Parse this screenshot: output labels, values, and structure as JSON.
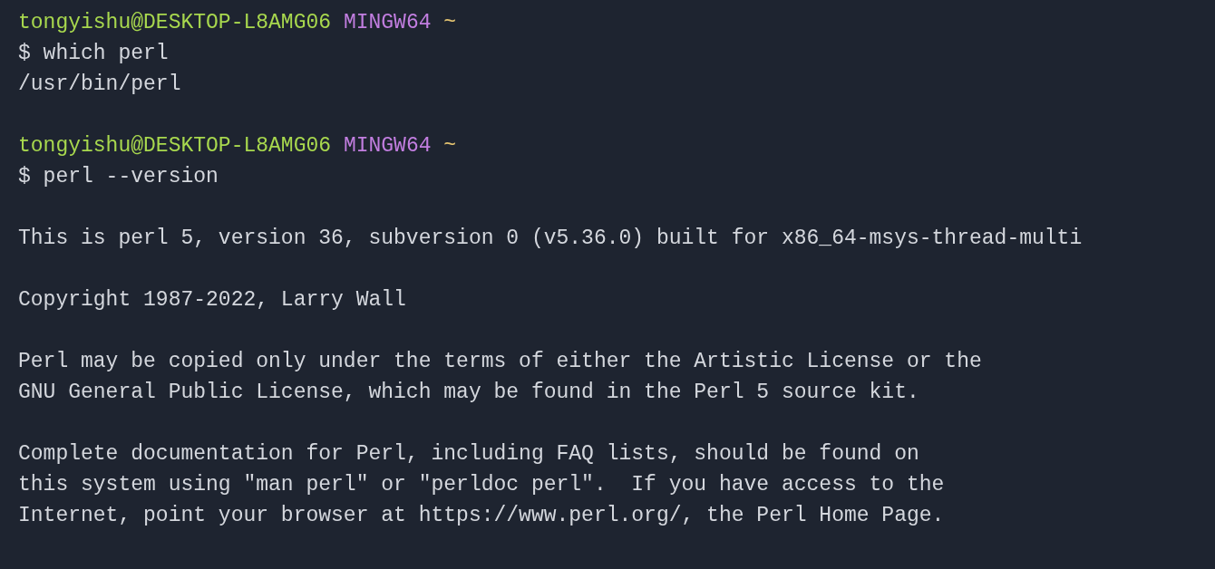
{
  "terminal": {
    "lines": [
      {
        "kind": "prompt",
        "user_host": "tongyishu@DESKTOP-L8AMG06",
        "system": "MINGW64",
        "path": "~"
      },
      {
        "kind": "command",
        "text": "$ which perl"
      },
      {
        "kind": "output",
        "text": "/usr/bin/perl"
      },
      {
        "kind": "blank"
      },
      {
        "kind": "prompt",
        "user_host": "tongyishu@DESKTOP-L8AMG06",
        "system": "MINGW64",
        "path": "~"
      },
      {
        "kind": "command",
        "text": "$ perl --version"
      },
      {
        "kind": "blank"
      },
      {
        "kind": "output",
        "text": "This is perl 5, version 36, subversion 0 (v5.36.0) built for x86_64-msys-thread-multi"
      },
      {
        "kind": "blank"
      },
      {
        "kind": "output",
        "text": "Copyright 1987-2022, Larry Wall"
      },
      {
        "kind": "blank"
      },
      {
        "kind": "output",
        "text": "Perl may be copied only under the terms of either the Artistic License or the"
      },
      {
        "kind": "output",
        "text": "GNU General Public License, which may be found in the Perl 5 source kit."
      },
      {
        "kind": "blank"
      },
      {
        "kind": "output",
        "text": "Complete documentation for Perl, including FAQ lists, should be found on"
      },
      {
        "kind": "output",
        "text": "this system using \"man perl\" or \"perldoc perl\".  If you have access to the"
      },
      {
        "kind": "output",
        "text": "Internet, point your browser at https://www.perl.org/, the Perl Home Page."
      }
    ]
  }
}
